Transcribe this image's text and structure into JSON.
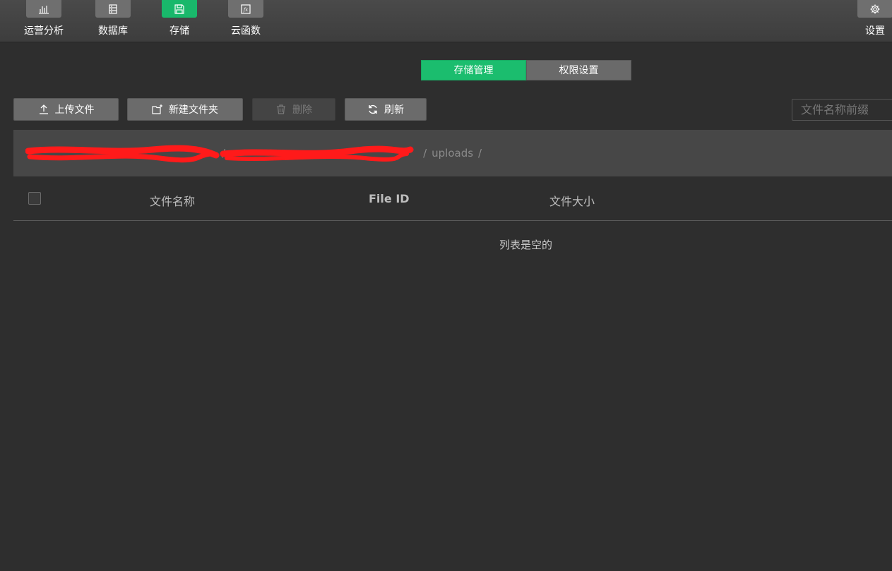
{
  "nav": {
    "items": [
      {
        "label": "运营分析",
        "icon": "bar-chart-icon",
        "active": false
      },
      {
        "label": "数据库",
        "icon": "database-icon",
        "active": false
      },
      {
        "label": "存储",
        "icon": "save-icon",
        "active": true
      },
      {
        "label": "云函数",
        "icon": "function-icon",
        "active": false
      }
    ],
    "settings_label": "设置",
    "settings_icon": "gear-icon"
  },
  "tabs": [
    {
      "label": "存储管理",
      "active": true
    },
    {
      "label": "权限设置",
      "active": false
    }
  ],
  "toolbar": {
    "upload_label": "上传文件",
    "new_folder_label": "新建文件夹",
    "delete_label": "删除",
    "refresh_label": "刷新",
    "search_placeholder": "文件名称前缀"
  },
  "breadcrumb": {
    "redacted_1": "",
    "redacted_2": "",
    "folder": "uploads",
    "separator": "/"
  },
  "table": {
    "columns": [
      "文件名称",
      "File ID",
      "文件大小"
    ],
    "rows": [],
    "empty_text": "列表是空的"
  },
  "colors": {
    "accent": "#1bbd6e",
    "background": "#2e2e2e",
    "redaction": "#ff1a1a"
  }
}
